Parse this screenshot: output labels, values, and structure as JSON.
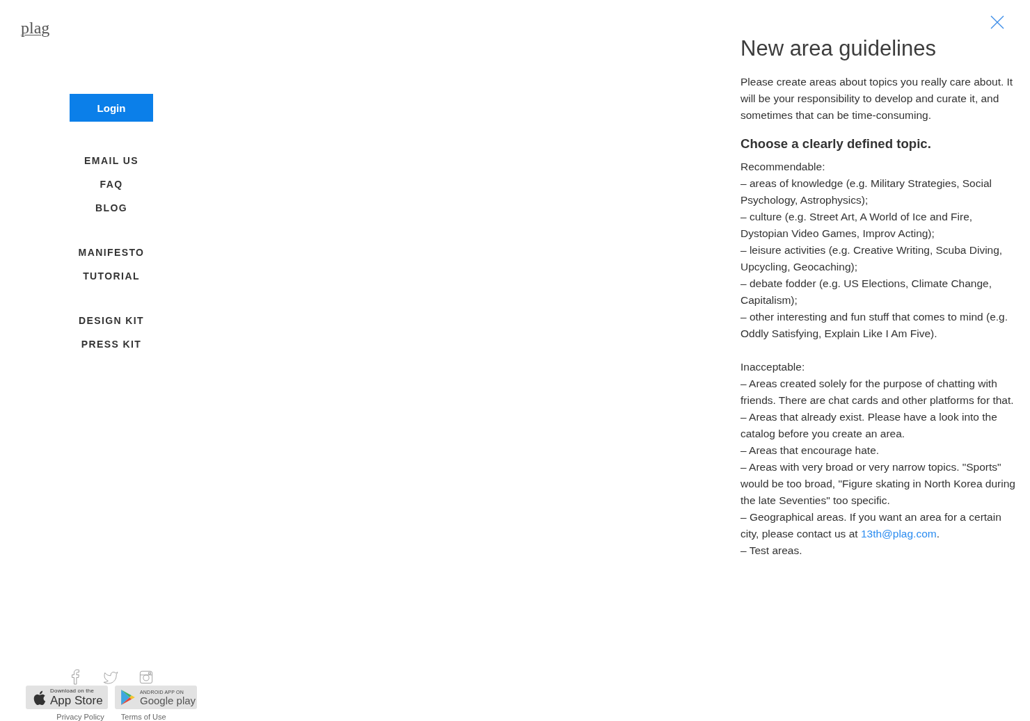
{
  "logo": {
    "text": "plag"
  },
  "sidebar": {
    "login_button": "Login",
    "nav_groups": [
      [
        "EMAIL US",
        "FAQ",
        "BLOG"
      ],
      [
        "MANIFESTO",
        "TUTORIAL"
      ],
      [
        "DESIGN KIT",
        "PRESS KIT"
      ]
    ],
    "store_badges": [
      {
        "kind": "apple",
        "small": "Download on the",
        "big": "App Store"
      },
      {
        "kind": "google",
        "small": "ANDROID APP ON",
        "big": "Google play"
      }
    ],
    "footer_links": [
      "Privacy Policy",
      "Terms of Use"
    ]
  },
  "panel": {
    "title": "New area guidelines",
    "intro": "Please create areas about topics you really care about. It will be your responsibility to develop and curate it, and sometimes that can be time-consuming.",
    "heading": "Choose a clearly defined topic.",
    "sections": [
      {
        "label": "Recommendable:",
        "items": [
          {
            "text": "– areas of knowledge (e.g. Military Strategies, Social Psychology, Astrophysics);"
          },
          {
            "text": "– culture (e.g. Street Art, A World of Ice and Fire, Dystopian Video Games, Improv Acting);"
          },
          {
            "text": "– leisure activities (e.g. Creative Writing, Scuba Diving, Upcycling, Geocaching);"
          },
          {
            "text": "– debate fodder (e.g. US Elections, Climate Change, Capitalism);"
          },
          {
            "text": "– other interesting and fun stuff that comes to mind (e.g. Oddly Satisfying, Explain Like I Am Five)."
          }
        ]
      },
      {
        "label": "Inacceptable:",
        "items": [
          {
            "text": "– Areas created solely for the purpose of chatting with friends. There are chat cards and other platforms for that."
          },
          {
            "text": "– Areas that already exist. Please have a look into the catalog before you create an area."
          },
          {
            "text": "– Areas that encourage hate."
          },
          {
            "text": "– Areas with very broad or very narrow topics. \"Sports\" would be too broad, \"Figure skating in North Korea during the late Seventies\" too specific."
          },
          {
            "text": "– Geographical areas. If you want an area for a certain city, please contact us at ",
            "link": "13th@plag.com",
            "after": "."
          },
          {
            "text": "– Test areas."
          }
        ]
      }
    ]
  }
}
